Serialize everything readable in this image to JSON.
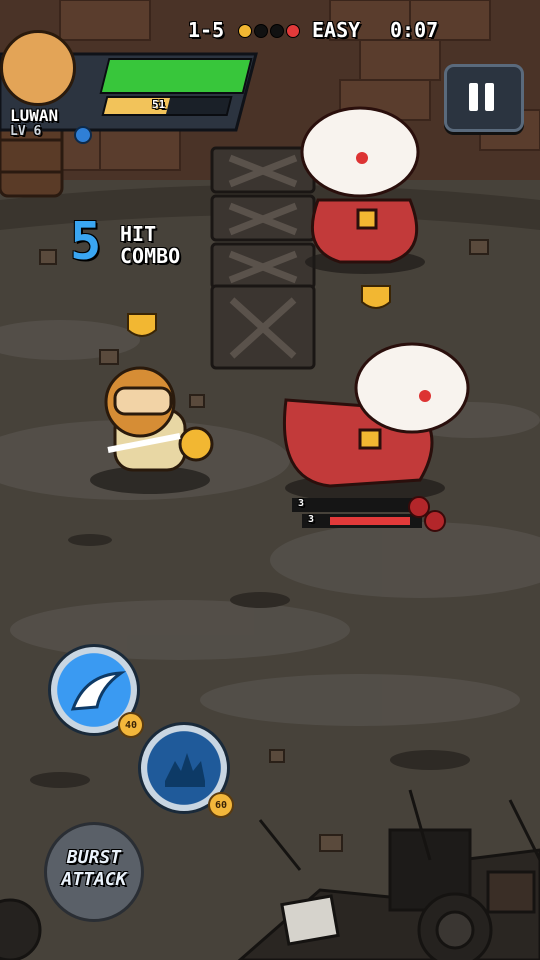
{
  "hud": {
    "player_name": "LUWAN",
    "player_level": "LV 6",
    "hp_fraction": 1.0,
    "xp_value": "51",
    "xp_fraction": 0.51,
    "stage": "1-5",
    "difficulty": "EASY",
    "timer": "0:07",
    "stage_dots": [
      {
        "color": "#f2b732"
      },
      {
        "color": "#111111"
      },
      {
        "color": "#111111"
      },
      {
        "color": "#e23a3a"
      }
    ],
    "pause_icon": "pause-icon"
  },
  "combo": {
    "count": "5",
    "line1": "HIT",
    "line2": "COMBO"
  },
  "enemy_status": {
    "row1_value": "3",
    "row2_value": "3",
    "row2_hp_fraction": 0.95
  },
  "skills": {
    "skill1_cost": "40",
    "skill2_cost": "60",
    "burst_label_line1": "BURST",
    "burst_label_line2": "ATTACK"
  },
  "colors": {
    "hp": "#38c63b",
    "xp": "#f2c35a",
    "enemy_hp": "#e23a3a",
    "combo": "#3aa6f2"
  }
}
